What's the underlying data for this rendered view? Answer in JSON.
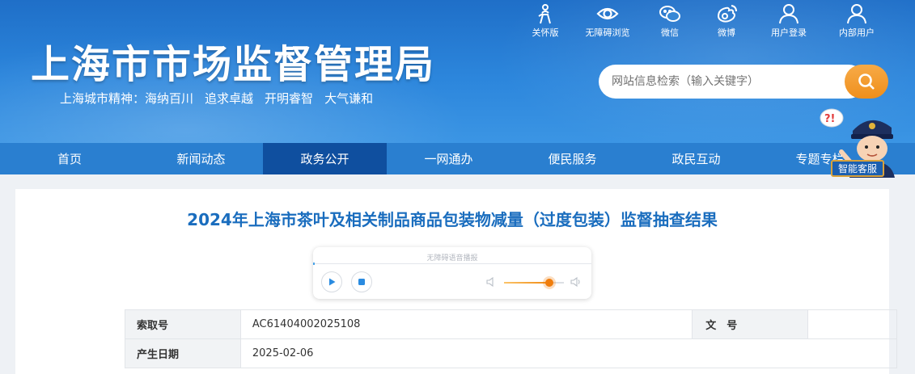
{
  "header": {
    "title": "上海市市场监督管理局",
    "spirit_prefix": "上海城市精神：",
    "spirit": [
      "海纳百川",
      "追求卓越",
      "开明睿智",
      "大气谦和"
    ]
  },
  "tools": [
    {
      "label": "关怀版",
      "icon": "care-mode-icon"
    },
    {
      "label": "无障碍浏览",
      "icon": "eye-icon"
    },
    {
      "label": "微信",
      "icon": "wechat-icon"
    },
    {
      "label": "微博",
      "icon": "weibo-icon"
    },
    {
      "label": "用户登录",
      "icon": "user-icon"
    },
    {
      "label": "内部用户",
      "icon": "user-icon"
    }
  ],
  "search": {
    "placeholder": "网站信息检索（输入关键字）"
  },
  "nav": {
    "items": [
      "首页",
      "新闻动态",
      "政务公开",
      "一网通办",
      "便民服务",
      "政民互动",
      "专题专栏"
    ],
    "active_index": 2
  },
  "service": {
    "label": "智能客服"
  },
  "article": {
    "title": "2024年上海市茶叶及相关制品商品包装物减量（过度包装）监督抽查结果"
  },
  "player": {
    "label": "无障碍语音播报",
    "volume_fraction": 0.75
  },
  "meta": {
    "index_label": "索取号",
    "index_value": "AC61404002025108",
    "doc_no_label": "文　号",
    "doc_no_value": "",
    "date_label": "产生日期",
    "date_value": "2025-02-06"
  },
  "colors": {
    "brand_blue": "#2a7fd0",
    "nav_active": "#0f4f9f",
    "title_blue": "#1a6dbe",
    "accent_orange": "#f08a12"
  }
}
